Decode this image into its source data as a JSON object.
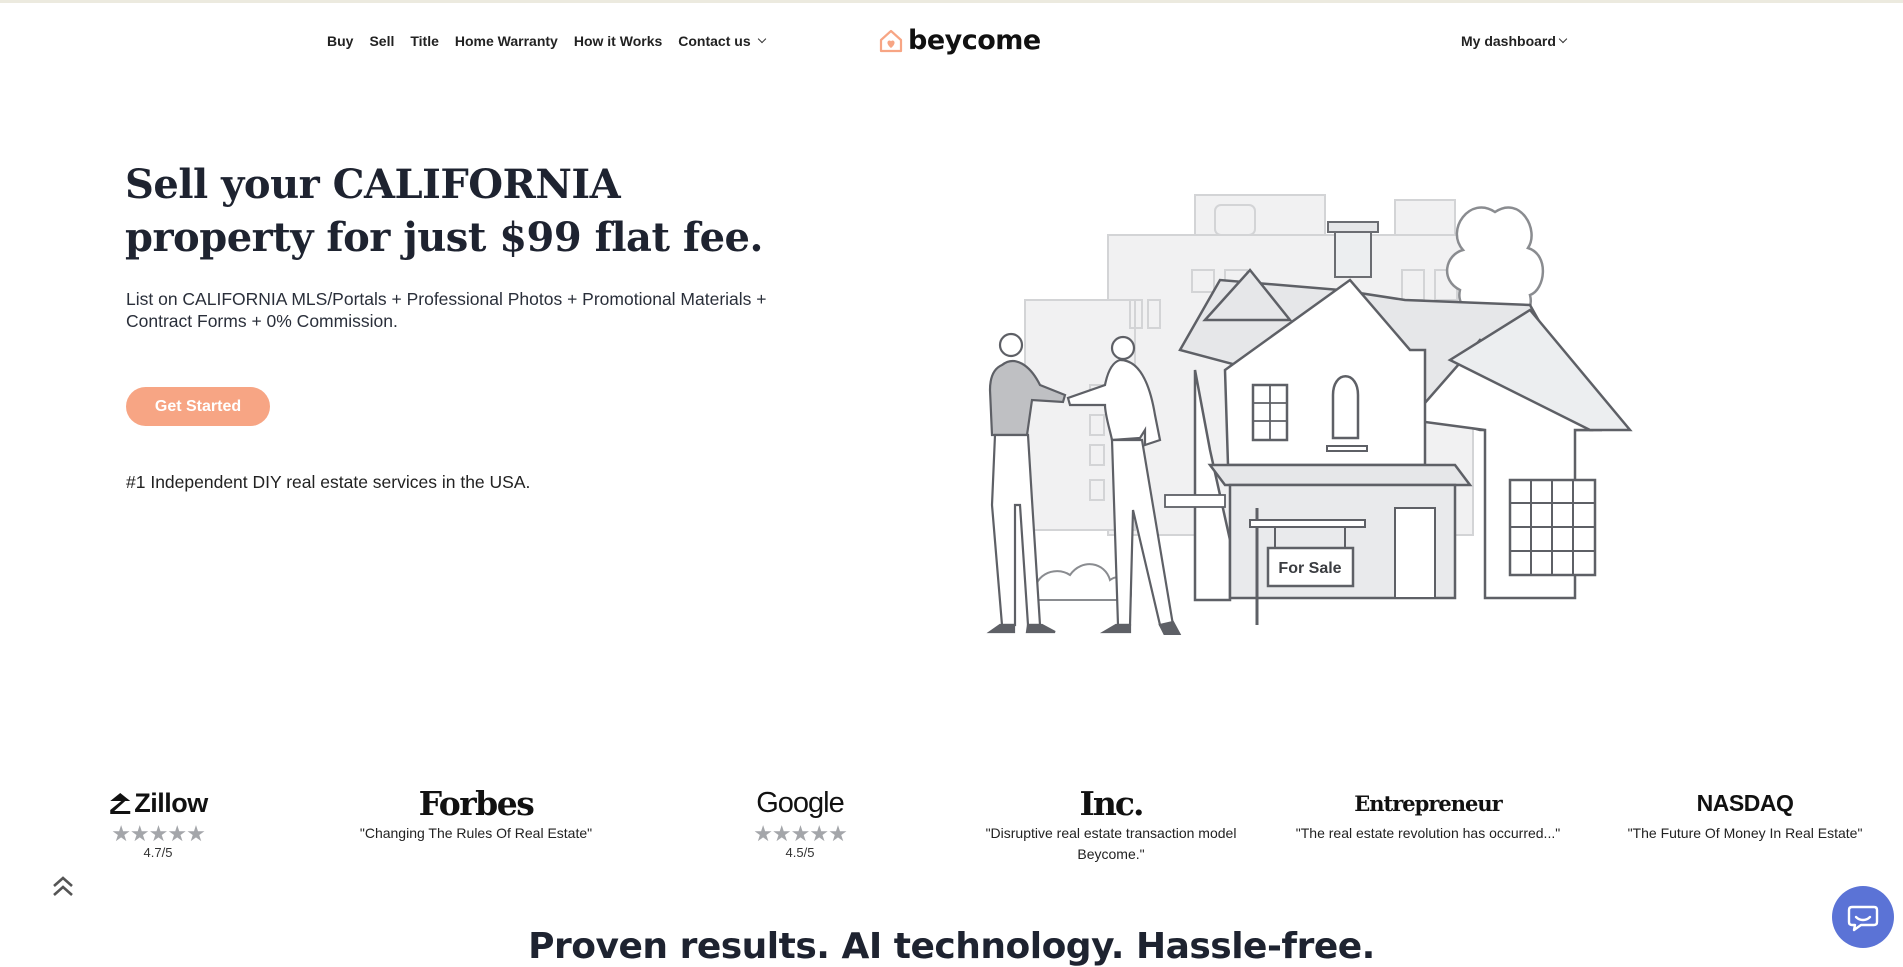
{
  "nav": {
    "items": [
      "Buy",
      "Sell",
      "Title",
      "Home Warranty",
      "How it Works"
    ],
    "contact": "Contact us",
    "dashboard": "My dashboard"
  },
  "logo": {
    "text": "beycome",
    "accent_color": "#f7a584"
  },
  "hero": {
    "title": "Sell your CALIFORNIA property for just $99 flat fee.",
    "subtitle": "List on CALIFORNIA MLS/Portals + Professional Photos + Promotional Materials + Contract Forms + 0% Commission.",
    "cta": "Get Started",
    "tagline": "#1 Independent DIY real estate services in the USA.",
    "sign_text": "For Sale"
  },
  "press": [
    {
      "logo": "Zillow",
      "stars": "★★★★★",
      "rating": "4.7/5"
    },
    {
      "logo": "Forbes",
      "quote": "\"Changing The Rules Of Real Estate\""
    },
    {
      "logo": "Google",
      "stars": "★★★★★",
      "rating": "4.5/5"
    },
    {
      "logo": "Inc.",
      "quote": "\"Disruptive real estate transaction model Beycome.\""
    },
    {
      "logo": "Entrepreneur",
      "quote": "\"The real estate revolution has occurred...\""
    },
    {
      "logo": "NASDAQ",
      "quote": "\"The Future Of Money In Real Estate\""
    }
  ],
  "section_heading": "Proven results. AI technology. Hassle-free.",
  "colors": {
    "accent": "#f7a584",
    "chat": "#5b73d6",
    "text": "#1e2330"
  },
  "icons": [
    "home-heart-icon",
    "chevron-down-icon",
    "double-chevron-up-icon",
    "chat-icon",
    "star-icon"
  ]
}
